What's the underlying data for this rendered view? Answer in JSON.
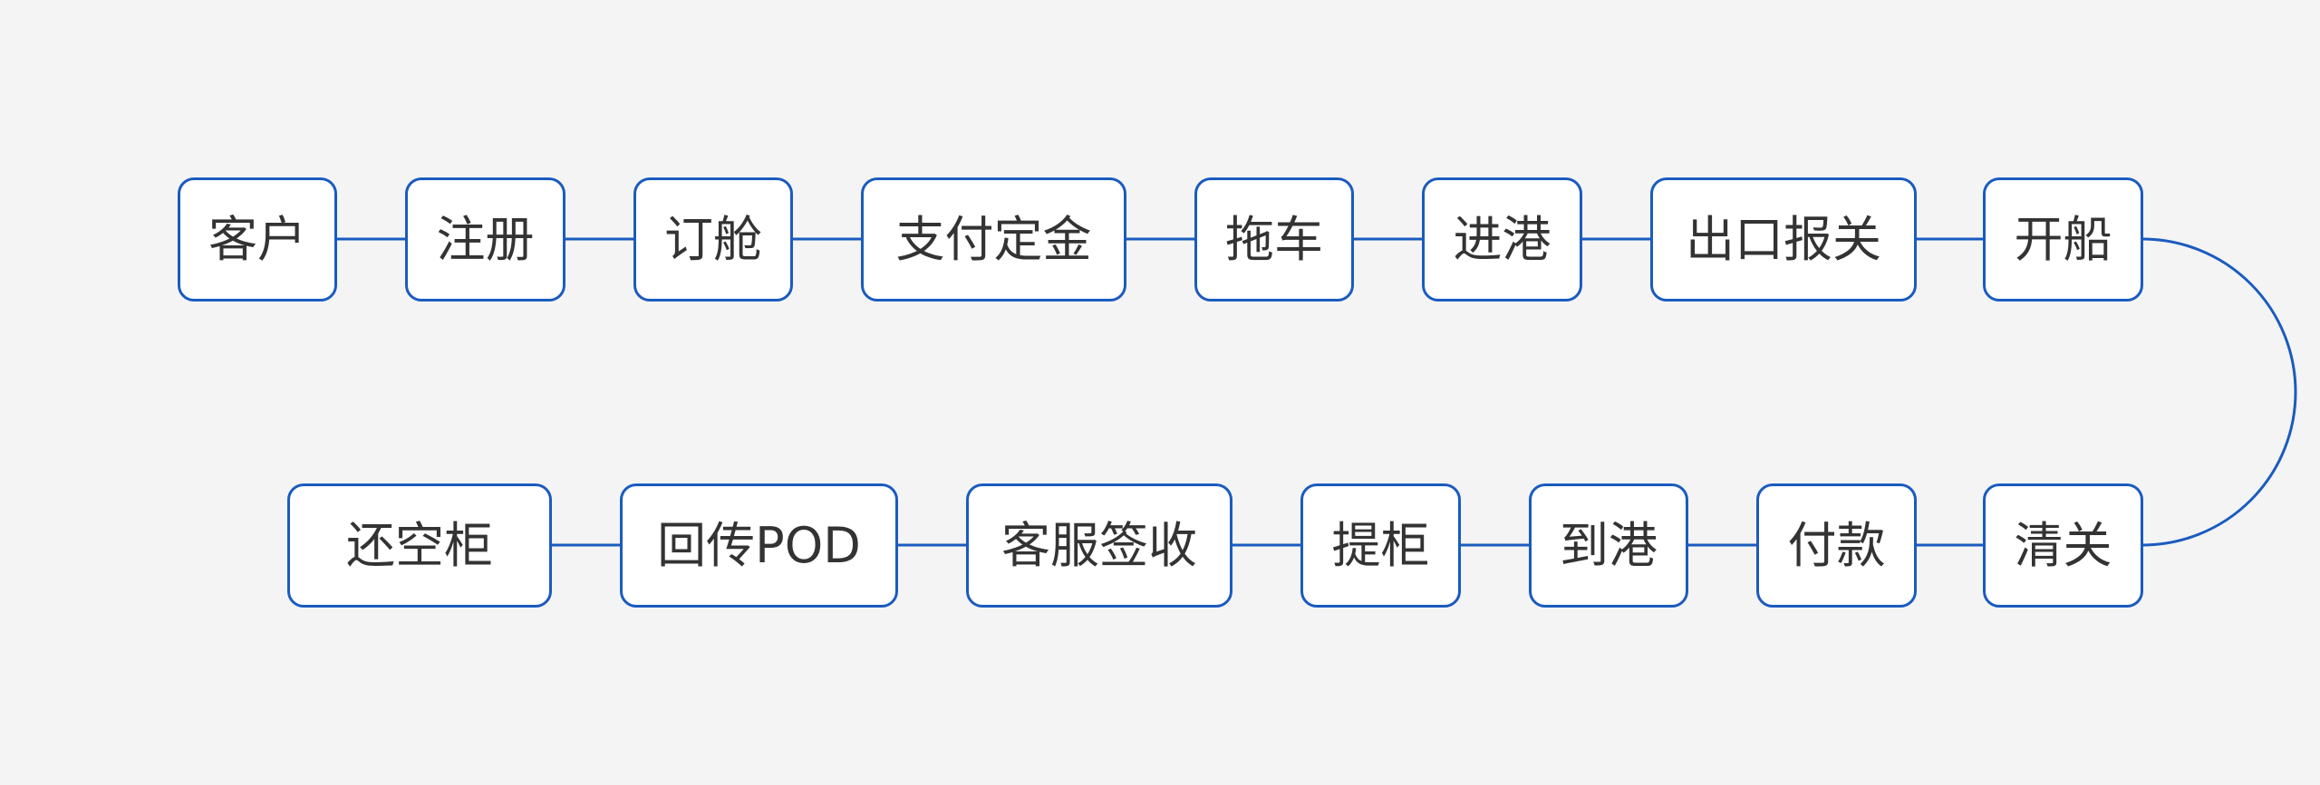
{
  "colors": {
    "background": "#f4f4f4",
    "node_border": "#1a5bbf",
    "node_fill": "#ffffff",
    "connector": "#1a5bbf",
    "text": "#333333"
  },
  "flow": {
    "top_row": [
      "客户",
      "注册",
      "订舱",
      "支付定金",
      "拖车",
      "进港",
      "出口报关",
      "开船"
    ],
    "bottom_row_right_to_left": [
      "清关",
      "付款",
      "到港",
      "提柜",
      "客服签收",
      "回传POD",
      "还空柜"
    ]
  },
  "nodes": {
    "t0": "客户",
    "t1": "注册",
    "t2": "订舱",
    "t3": "支付定金",
    "t4": "拖车",
    "t5": "进港",
    "t6": "出口报关",
    "t7": "开船",
    "b0": "还空柜",
    "b1": "回传POD",
    "b2": "客服签收",
    "b3": "提柜",
    "b4": "到港",
    "b5": "付款",
    "b6": "清关"
  }
}
